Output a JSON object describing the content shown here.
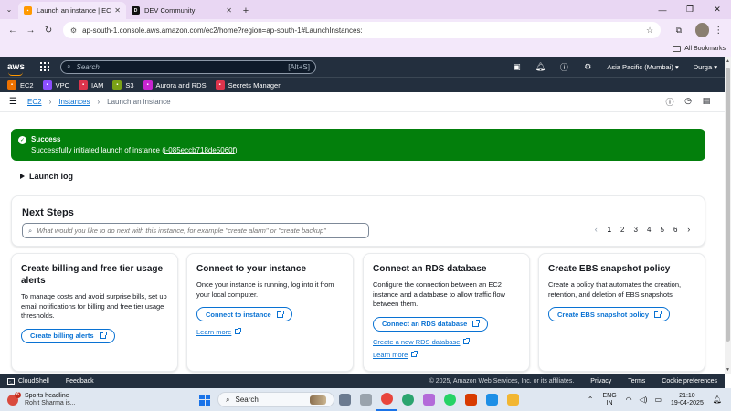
{
  "browser": {
    "tabs": [
      {
        "title": "Launch an instance | EC2 | ap-s",
        "active": true
      },
      {
        "title": "DEV Community",
        "active": false
      }
    ],
    "url": "ap-south-1.console.aws.amazon.com/ec2/home?region=ap-south-1#LaunchInstances:",
    "bookmarks_label": "All Bookmarks"
  },
  "aws_nav": {
    "logo": "aws",
    "search_placeholder": "Search",
    "search_shortcut": "[Alt+S]",
    "region": "Asia Pacific (Mumbai) ▾",
    "user": "Durga ▾"
  },
  "services": [
    {
      "label": "EC2",
      "color": "#ed7100",
      "icon": "chip-icon"
    },
    {
      "label": "VPC",
      "color": "#8c4fff",
      "icon": "cloud-icon"
    },
    {
      "label": "IAM",
      "color": "#dd344c",
      "icon": "key-icon"
    },
    {
      "label": "S3",
      "color": "#7aa116",
      "icon": "bucket-icon"
    },
    {
      "label": "Aurora and RDS",
      "color": "#c925d1",
      "icon": "database-icon"
    },
    {
      "label": "Secrets Manager",
      "color": "#dd344c",
      "icon": "lock-icon"
    }
  ],
  "breadcrumb": {
    "root": "EC2",
    "parent": "Instances",
    "current": "Launch an instance"
  },
  "flash": {
    "title": "Success",
    "message": "Successfully initiated launch of instance (",
    "instance_id": "i-085eccb718de5060f",
    "suffix": ")"
  },
  "launch_log": "Launch log",
  "next_steps": {
    "title": "Next Steps",
    "search_placeholder": "What would you like to do next with this instance, for example \"create alarm\" or \"create backup\"",
    "pages": [
      "1",
      "2",
      "3",
      "4",
      "5",
      "6"
    ],
    "current_page": "1"
  },
  "cards": [
    {
      "title": "Create billing and free tier usage alerts",
      "desc": "To manage costs and avoid surprise bills, set up email notifications for billing and free tier usage thresholds.",
      "button": "Create billing alerts",
      "links": []
    },
    {
      "title": "Connect to your instance",
      "desc": "Once your instance is running, log into it from your local computer.",
      "button": "Connect to instance",
      "links": [
        "Learn more"
      ]
    },
    {
      "title": "Connect an RDS database",
      "desc": "Configure the connection between an EC2 instance and a database to allow traffic flow between them.",
      "button": "Connect an RDS database",
      "links": [
        "Create a new RDS database",
        "Learn more"
      ]
    },
    {
      "title": "Create EBS snapshot policy",
      "desc": "Create a policy that automates the creation, retention, and deletion of EBS snapshots",
      "button": "Create EBS snapshot policy",
      "links": []
    }
  ],
  "footer": {
    "cloudshell": "CloudShell",
    "feedback": "Feedback",
    "copyright": "© 2025, Amazon Web Services, Inc. or its affiliates.",
    "privacy": "Privacy",
    "terms": "Terms",
    "cookies": "Cookie preferences"
  },
  "taskbar": {
    "weather_badge": "6",
    "weather_title": "Sports headline",
    "weather_sub": "Rohit Sharma is...",
    "search": "Search",
    "lang": "ENG",
    "lang_region": "IN",
    "time": "21:10",
    "date": "19-04-2025"
  },
  "colors": {
    "aws_dark": "#232f3e",
    "success": "#037f0c",
    "link": "#0972d3"
  }
}
